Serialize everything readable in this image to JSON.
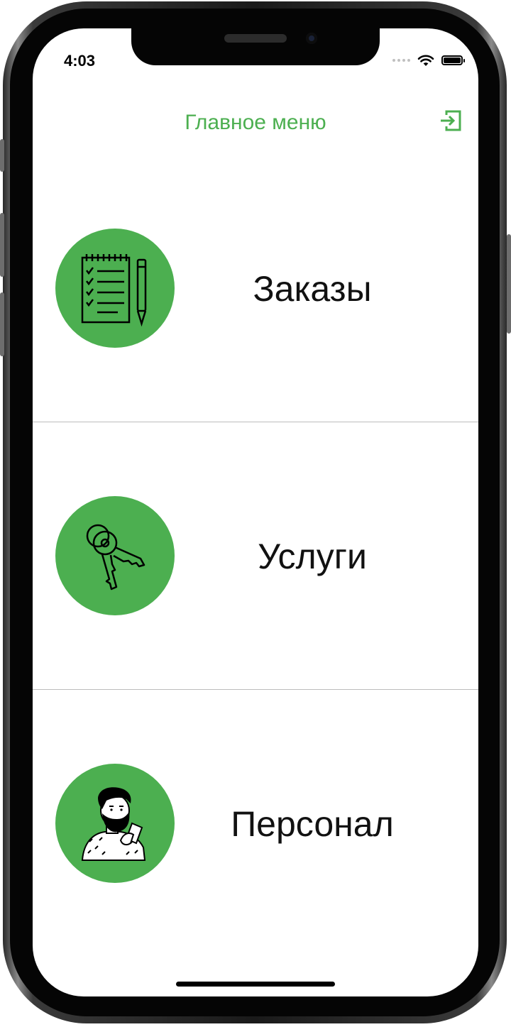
{
  "status_bar": {
    "time": "4:03"
  },
  "header": {
    "title": "Главное меню",
    "logout_icon": "logout-icon"
  },
  "menu": {
    "items": [
      {
        "label": "Заказы",
        "icon": "notepad-checklist-icon"
      },
      {
        "label": "Услуги",
        "icon": "keys-icon"
      },
      {
        "label": "Персонал",
        "icon": "bearded-man-icon"
      }
    ]
  },
  "colors": {
    "accent": "#4caf50",
    "text": "#111111",
    "separator": "#bdbdbd",
    "background": "#ffffff"
  }
}
